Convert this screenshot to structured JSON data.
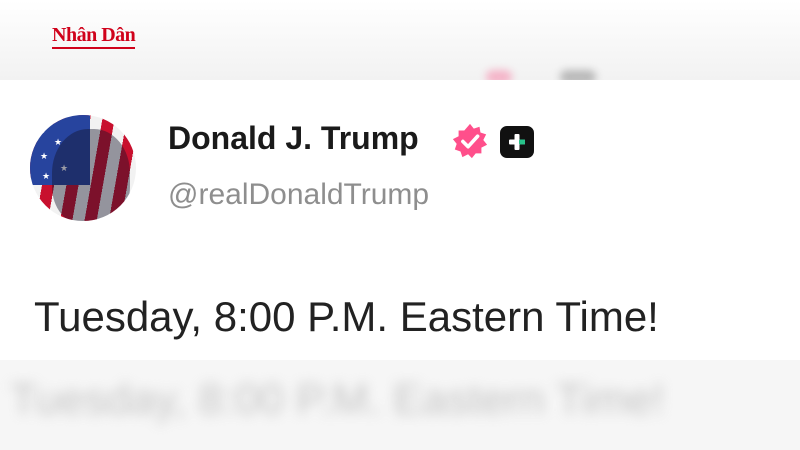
{
  "watermark": {
    "text": "Nhân Dân"
  },
  "post": {
    "display_name": "Donald J. Trump",
    "username": "@realDonaldTrump",
    "text": "Tuesday, 8:00 P.M. Eastern Time!"
  },
  "icons": {
    "avatar": "flag-portrait-avatar",
    "verified": "verified-badge-icon",
    "plus": "plus-badge-icon"
  },
  "colors": {
    "verified_badge": "#ff4f8b",
    "watermark": "#d0021b",
    "username": "#8e8e8e"
  }
}
